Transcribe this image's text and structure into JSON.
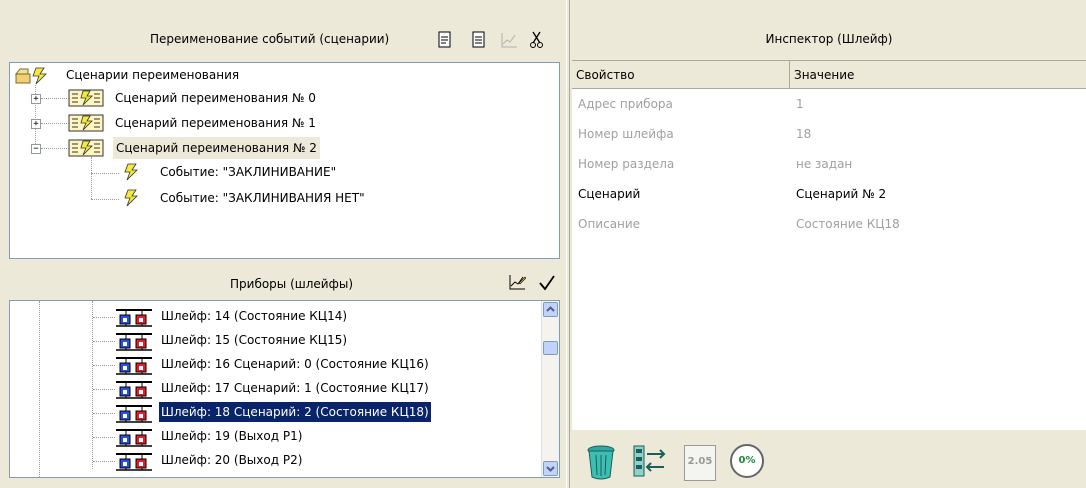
{
  "scenarios_panel": {
    "title": "Переименование событий (сценарии)",
    "root_label": "Сценарии переименования",
    "items": [
      {
        "label": "Сценарий переименования № 0",
        "expander": "+"
      },
      {
        "label": "Сценарий переименования № 1",
        "expander": "+"
      },
      {
        "label": "Сценарий переименования № 2",
        "expander": "−"
      }
    ],
    "events": [
      "Событие: \"ЗАКЛИНИВАНИЕ\"",
      "Событие: \"ЗАКЛИНИВАНИЯ НЕТ\""
    ]
  },
  "devices_panel": {
    "title": "Приборы (шлейфы)",
    "items": [
      "Шлейф: 14 (Состояние КЦ14)",
      "Шлейф: 15 (Состояние КЦ15)",
      "Шлейф: 16 Сценарий: 0 (Состояние КЦ16)",
      "Шлейф: 17 Сценарий: 1 (Состояние КЦ17)",
      "Шлейф: 18 Сценарий: 2 (Состояние КЦ18)",
      "Шлейф: 19 (Выход Р1)",
      "Шлейф: 20 (Выход Р2)"
    ],
    "selected_index": 4
  },
  "inspector": {
    "title": "Инспектор (Шлейф)",
    "col_property": "Свойство",
    "col_value": "Значение",
    "rows": [
      {
        "prop": "Адрес прибора",
        "value": "1",
        "enabled": false
      },
      {
        "prop": "Номер шлейфа",
        "value": "18",
        "enabled": false
      },
      {
        "prop": "Номер раздела",
        "value": "не задан",
        "enabled": false
      },
      {
        "prop": "Сценарий",
        "value": "Сценарий № 2",
        "enabled": true
      },
      {
        "prop": "Описание",
        "value": "Состояние КЦ18",
        "enabled": false
      }
    ]
  },
  "bottom_toolbar": {
    "version_label": "2.05",
    "progress_label": "0%"
  },
  "icons": [
    "document-icon",
    "document-edit-icon",
    "chart-icon",
    "scissors-icon",
    "trash-icon",
    "swap-icon",
    "version-icon",
    "progress-icon",
    "checkmark-icon"
  ]
}
